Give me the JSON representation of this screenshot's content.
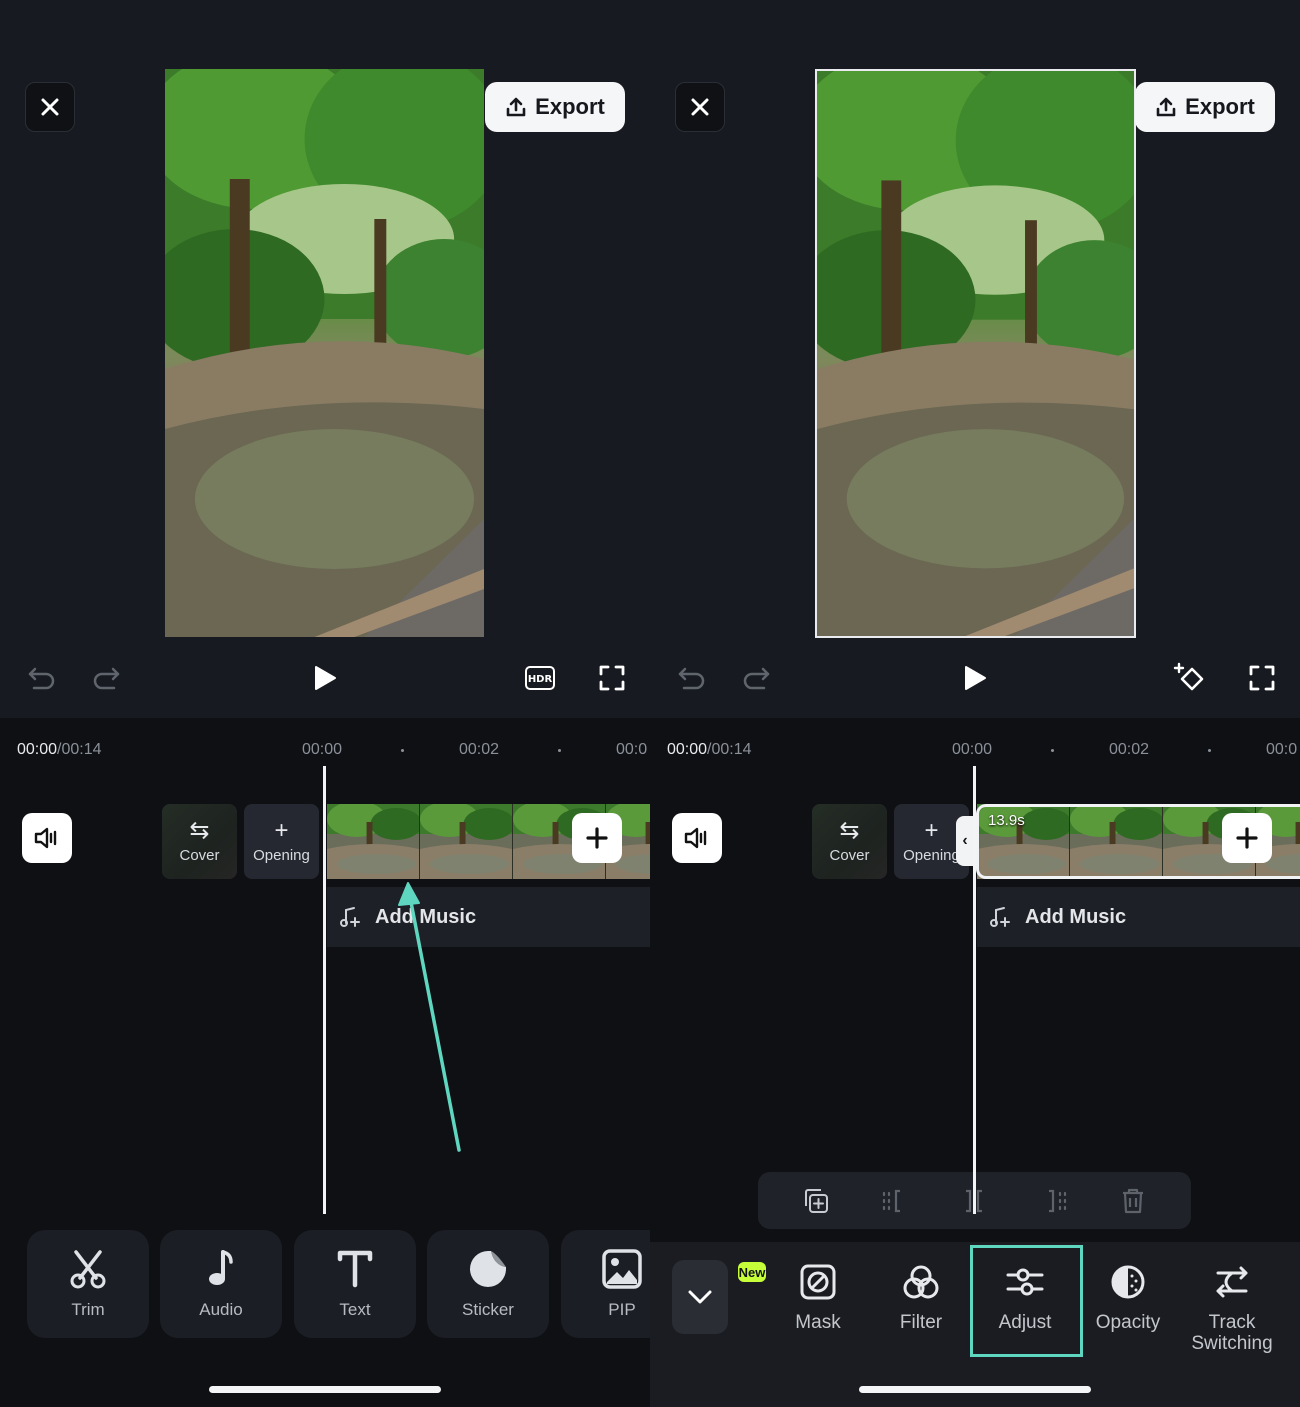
{
  "left": {
    "export_label": "Export",
    "time_current": "00:00",
    "time_total": "/00:14",
    "ruler": [
      "00:00",
      "00:02",
      "00:0"
    ],
    "cover_label": "Cover",
    "opening_label": "Opening",
    "add_music_label": "Add Music",
    "tools": [
      {
        "label": "Trim",
        "icon": "scissors-icon"
      },
      {
        "label": "Audio",
        "icon": "music-note-icon"
      },
      {
        "label": "Text",
        "icon": "text-icon"
      },
      {
        "label": "Sticker",
        "icon": "sticker-icon"
      },
      {
        "label": "PIP",
        "icon": "pip-icon"
      }
    ]
  },
  "right": {
    "export_label": "Export",
    "time_current": "00:00",
    "time_total": "/00:14",
    "ruler": [
      "00:00",
      "00:02",
      "00:0"
    ],
    "cover_label": "Cover",
    "opening_label": "Opening",
    "clip_duration": "13.9s",
    "add_music_label": "Add Music",
    "new_badge": "New",
    "panel_tools": [
      {
        "label": "Mask",
        "icon": "mask-icon"
      },
      {
        "label": "Filter",
        "icon": "filter-icon"
      },
      {
        "label": "Adjust",
        "icon": "adjust-icon"
      },
      {
        "label": "Opacity",
        "icon": "opacity-icon"
      },
      {
        "label": "Track\nSwitching",
        "icon": "track-switching-icon"
      }
    ]
  },
  "colors": {
    "accent": "#5fd6bf",
    "new_badge": "#c6ff3a",
    "background": "#14161b"
  }
}
